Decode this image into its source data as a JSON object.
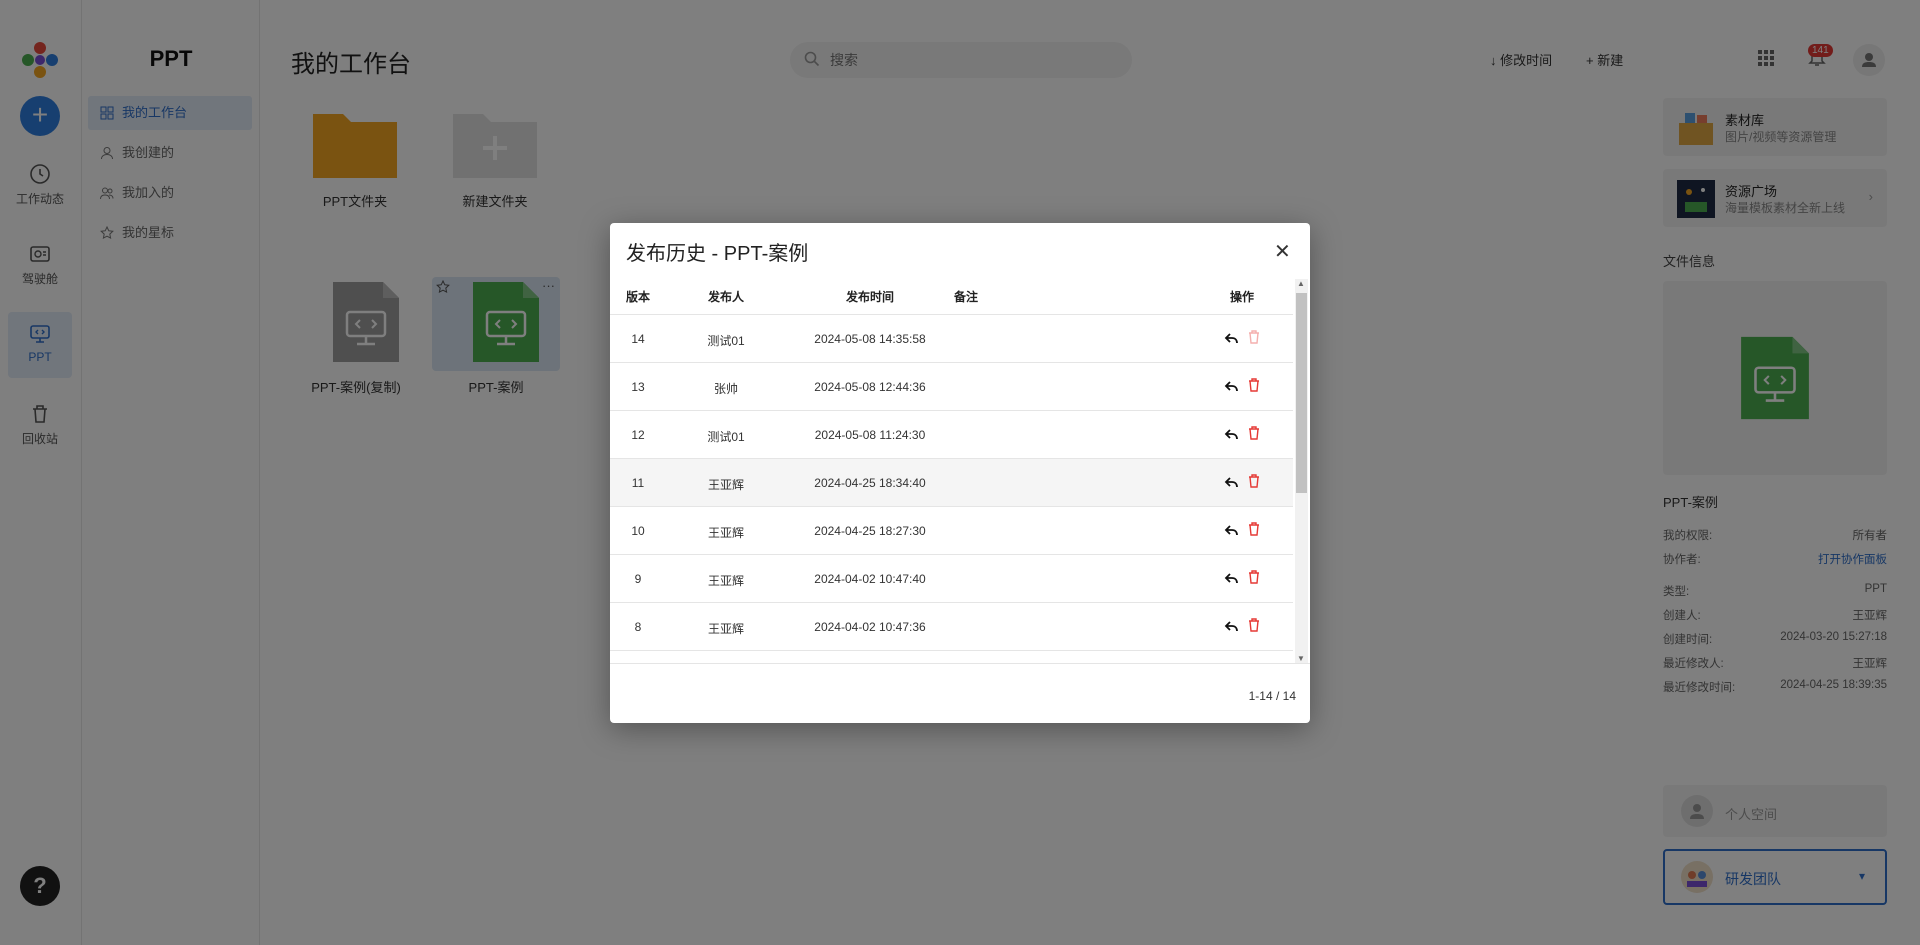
{
  "rail": {
    "items": [
      {
        "label": "工作动态"
      },
      {
        "label": "驾驶舱"
      },
      {
        "label": "PPT"
      },
      {
        "label": "回收站"
      }
    ],
    "help": "?"
  },
  "subnav": {
    "title": "PPT",
    "items": [
      {
        "label": "我的工作台"
      },
      {
        "label": "我创建的"
      },
      {
        "label": "我加入的"
      },
      {
        "label": "我的星标"
      }
    ]
  },
  "main": {
    "title": "我的工作台",
    "search_placeholder": "搜索",
    "sort_label": "修改时间",
    "new_label": "新建",
    "notification_count": "141",
    "folders": [
      {
        "label": "PPT文件夹"
      },
      {
        "label": "新建文件夹"
      }
    ],
    "files": [
      {
        "label": "PPT-案例(复制)"
      },
      {
        "label": "PPT-案例"
      }
    ]
  },
  "right_panel": {
    "library": {
      "title": "素材库",
      "subtitle": "图片/视频等资源管理"
    },
    "square": {
      "title": "资源广场",
      "subtitle": "海量模板素材全新上线"
    },
    "file_info_label": "文件信息",
    "file_name": "PPT-案例",
    "info": [
      {
        "k": "我的权限:",
        "v": "所有者"
      },
      {
        "k": "协作者:",
        "v": "打开协作面板"
      },
      {
        "k": "类型:",
        "v": "PPT"
      },
      {
        "k": "创建人:",
        "v": "王亚辉"
      },
      {
        "k": "创建时间:",
        "v": "2024-03-20 15:27:18"
      },
      {
        "k": "最近修改人:",
        "v": "王亚辉"
      },
      {
        "k": "最近修改时间:",
        "v": "2024-04-25 18:39:35"
      }
    ],
    "personal_space": "个人空间",
    "team": "研发团队"
  },
  "modal": {
    "title": "发布历史 - PPT-案例",
    "columns": {
      "version": "版本",
      "publisher": "发布人",
      "time": "发布时间",
      "note": "备注",
      "ops": "操作"
    },
    "rows": [
      {
        "version": "14",
        "publisher": "测试01",
        "time": "2024-05-08 14:35:58",
        "note": ""
      },
      {
        "version": "13",
        "publisher": "张帅",
        "time": "2024-05-08 12:44:36",
        "note": ""
      },
      {
        "version": "12",
        "publisher": "测试01",
        "time": "2024-05-08 11:24:30",
        "note": ""
      },
      {
        "version": "11",
        "publisher": "王亚辉",
        "time": "2024-04-25 18:34:40",
        "note": ""
      },
      {
        "version": "10",
        "publisher": "王亚辉",
        "time": "2024-04-25 18:27:30",
        "note": ""
      },
      {
        "version": "9",
        "publisher": "王亚辉",
        "time": "2024-04-02 10:47:40",
        "note": ""
      },
      {
        "version": "8",
        "publisher": "王亚辉",
        "time": "2024-04-02 10:47:36",
        "note": ""
      }
    ],
    "pagination": "1-14 / 14"
  },
  "colors": {
    "accent": "#2f6fca",
    "folder": "#f5a623",
    "ppt_green": "#4caf50",
    "delete": "#e53935"
  }
}
